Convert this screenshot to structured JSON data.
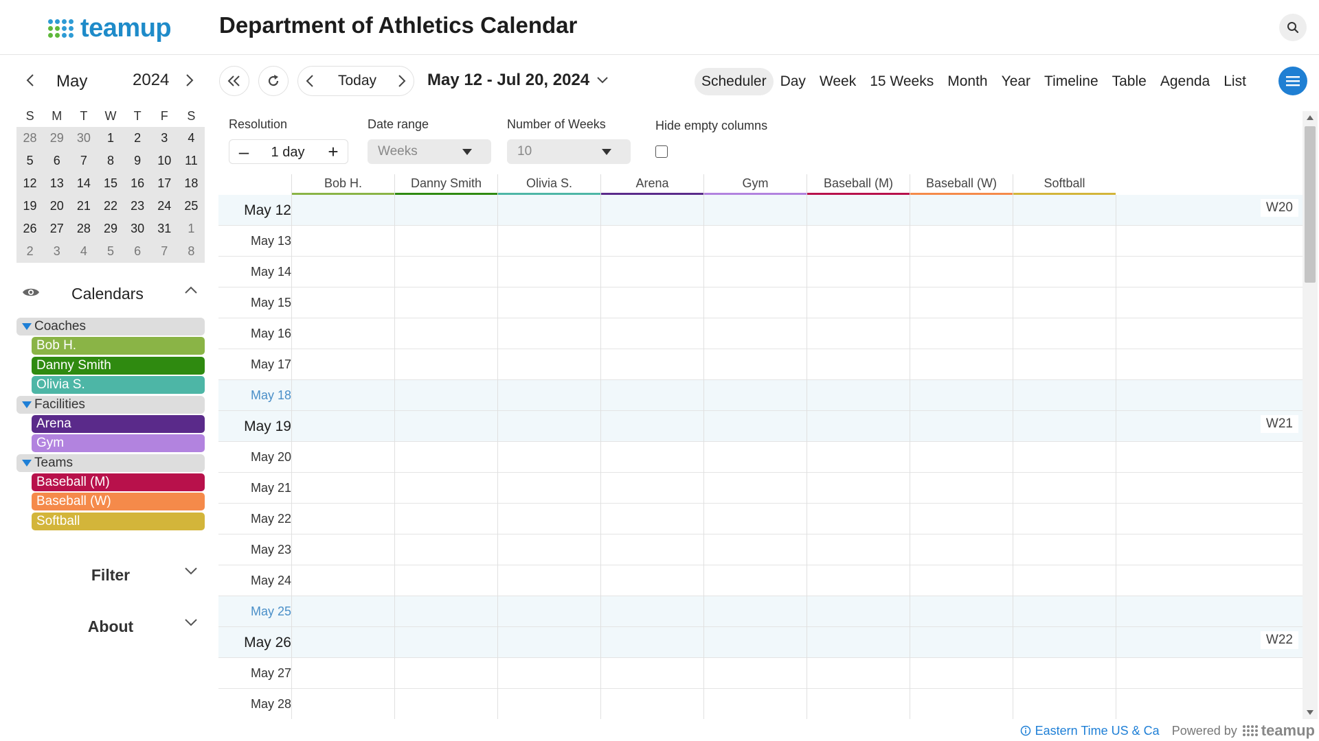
{
  "app": {
    "logo_text": "teamup",
    "title": "Department of Athletics Calendar"
  },
  "mini_calendar": {
    "month": "May",
    "year": "2024",
    "dow": [
      "S",
      "M",
      "T",
      "W",
      "T",
      "F",
      "S"
    ],
    "weeks": [
      [
        "28",
        "29",
        "30",
        "1",
        "2",
        "3",
        "4"
      ],
      [
        "5",
        "6",
        "7",
        "8",
        "9",
        "10",
        "11"
      ],
      [
        "12",
        "13",
        "14",
        "15",
        "16",
        "17",
        "18"
      ],
      [
        "19",
        "20",
        "21",
        "22",
        "23",
        "24",
        "25"
      ],
      [
        "26",
        "27",
        "28",
        "29",
        "30",
        "31",
        "1"
      ],
      [
        "2",
        "3",
        "4",
        "5",
        "6",
        "7",
        "8"
      ]
    ]
  },
  "sidebar": {
    "calendars_title": "Calendars",
    "groups": [
      {
        "name": "Coaches",
        "items": [
          {
            "name": "Bob H.",
            "color": "#8ab446"
          },
          {
            "name": "Danny Smith",
            "color": "#2f8a10"
          },
          {
            "name": "Olivia S.",
            "color": "#4db6a6"
          }
        ]
      },
      {
        "name": "Facilities",
        "items": [
          {
            "name": "Arena",
            "color": "#5a2a8a"
          },
          {
            "name": "Gym",
            "color": "#b283df"
          }
        ]
      },
      {
        "name": "Teams",
        "items": [
          {
            "name": "Baseball (M)",
            "color": "#b8114b"
          },
          {
            "name": "Baseball (W)",
            "color": "#f58a4a"
          },
          {
            "name": "Softball",
            "color": "#d3b53a"
          }
        ]
      }
    ],
    "filter_label": "Filter",
    "about_label": "About"
  },
  "toolbar": {
    "today_label": "Today",
    "date_range": "May 12 - Jul 20, 2024",
    "views": [
      "Scheduler",
      "Day",
      "Week",
      "15 Weeks",
      "Month",
      "Year",
      "Timeline",
      "Table",
      "Agenda",
      "List"
    ],
    "active_view": "Scheduler"
  },
  "options": {
    "resolution_label": "Resolution",
    "resolution_value": "1 day",
    "date_range_label": "Date range",
    "date_range_value": "Weeks",
    "weeks_label": "Number of Weeks",
    "weeks_value": "10",
    "hide_empty_label": "Hide empty columns"
  },
  "grid": {
    "columns": [
      {
        "name": "Bob H.",
        "color": "#8ab446"
      },
      {
        "name": "Danny Smith",
        "color": "#2f8a10"
      },
      {
        "name": "Olivia S.",
        "color": "#4db6a6"
      },
      {
        "name": "Arena",
        "color": "#5a2a8a"
      },
      {
        "name": "Gym",
        "color": "#b283df"
      },
      {
        "name": "Baseball (M)",
        "color": "#b8114b"
      },
      {
        "name": "Baseball (W)",
        "color": "#f58a4a"
      },
      {
        "name": "Softball",
        "color": "#d3b53a"
      }
    ],
    "rows": [
      {
        "date": "May 12",
        "type": "sun",
        "week": "W20"
      },
      {
        "date": "May 13",
        "type": "",
        "week": ""
      },
      {
        "date": "May 14",
        "type": "",
        "week": ""
      },
      {
        "date": "May 15",
        "type": "",
        "week": ""
      },
      {
        "date": "May 16",
        "type": "",
        "week": ""
      },
      {
        "date": "May 17",
        "type": "",
        "week": ""
      },
      {
        "date": "May 18",
        "type": "sat",
        "week": ""
      },
      {
        "date": "May 19",
        "type": "sun",
        "week": "W21"
      },
      {
        "date": "May 20",
        "type": "",
        "week": ""
      },
      {
        "date": "May 21",
        "type": "",
        "week": ""
      },
      {
        "date": "May 22",
        "type": "",
        "week": ""
      },
      {
        "date": "May 23",
        "type": "",
        "week": ""
      },
      {
        "date": "May 24",
        "type": "",
        "week": ""
      },
      {
        "date": "May 25",
        "type": "sat",
        "week": ""
      },
      {
        "date": "May 26",
        "type": "sun",
        "week": "W22"
      },
      {
        "date": "May 27",
        "type": "",
        "week": ""
      },
      {
        "date": "May 28",
        "type": "",
        "week": ""
      }
    ]
  },
  "footer": {
    "timezone": "Eastern Time US & Ca",
    "powered_by": "Powered by",
    "brand": "teamup"
  }
}
